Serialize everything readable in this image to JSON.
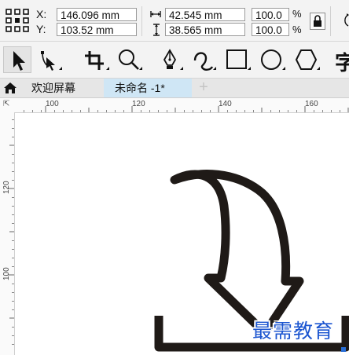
{
  "property_bar": {
    "x_label": "X:",
    "y_label": "Y:",
    "x_value": "146.096 mm",
    "y_value": "103.52 mm",
    "width_value": "42.545 mm",
    "height_value": "38.565 mm",
    "scale_w": "100.0",
    "scale_h": "100.0",
    "percent": "%"
  },
  "toolbox": {
    "tools": [
      "pick-tool",
      "shape-tool",
      "crop-tool",
      "zoom-tool",
      "pen-tool",
      "freehand-tool",
      "rectangle-tool",
      "ellipse-tool",
      "polygon-tool",
      "text-tool"
    ],
    "text_tool_glyph": "字"
  },
  "tabs": {
    "welcome": "欢迎屏幕",
    "document": "未命名 -1*",
    "add": "+"
  },
  "ruler": {
    "h_ticks": [
      "100",
      "120",
      "140",
      "160"
    ],
    "v_ticks": [
      "120",
      "100"
    ],
    "corner": "⇱"
  },
  "watermark": "最需教育"
}
